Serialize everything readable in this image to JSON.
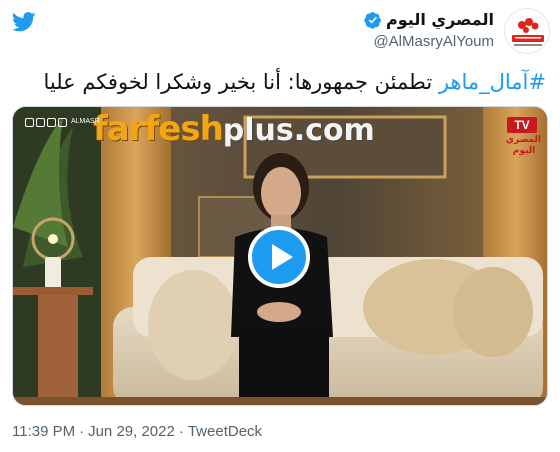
{
  "author": {
    "name": "المصري اليوم",
    "handle": "@AlMasryAlYoum",
    "avatar_alt_icon": "almasry-alyoum-logo",
    "verified_icon": "verified-badge-icon"
  },
  "brand_icon": "twitter-bird-icon",
  "tweet": {
    "hashtag": "#آمال_ماهر",
    "text": " تطمئن جمهورها: أنا بخير وشكرا لخوفكم عليا"
  },
  "media": {
    "watermark_part1": "farfesh",
    "watermark_part2": "plus.com",
    "corner_text": "ALMASR",
    "channel_logo_tv": "TV",
    "channel_logo_line1": "المصري",
    "channel_logo_line2": "اليوم",
    "play_icon": "play-icon"
  },
  "footer": {
    "time": "11:39 PM",
    "separator": "·",
    "date": "Jun 29, 2022",
    "source": "TweetDeck"
  },
  "colors": {
    "link": "#1d9bf0",
    "secondary_text": "#536471",
    "watermark_orange": "#f2a612",
    "channel_red": "#c9191e"
  }
}
